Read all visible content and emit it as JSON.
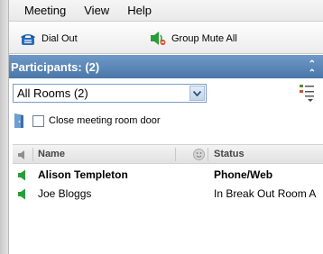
{
  "menu": {
    "items": [
      {
        "label": "Meeting"
      },
      {
        "label": "View"
      },
      {
        "label": "Help"
      }
    ]
  },
  "toolbar": {
    "dial_out_label": "Dial Out",
    "group_mute_label": "Group Mute All"
  },
  "participants": {
    "title": "Participants: (2)",
    "room_select": {
      "selected": "All Rooms  (2)"
    },
    "close_door_label": "Close meeting room door",
    "close_door_checked": false,
    "columns": {
      "name": "Name",
      "status": "Status"
    },
    "rows": [
      {
        "name": "Alison Templeton",
        "status": "Phone/Web",
        "bold": true
      },
      {
        "name": "Joe Bloggs",
        "status": "In Break Out Room A",
        "bold": false
      }
    ]
  },
  "colors": {
    "header_blue": "#4a77a8",
    "speaker_green": "#2a9d3a"
  }
}
